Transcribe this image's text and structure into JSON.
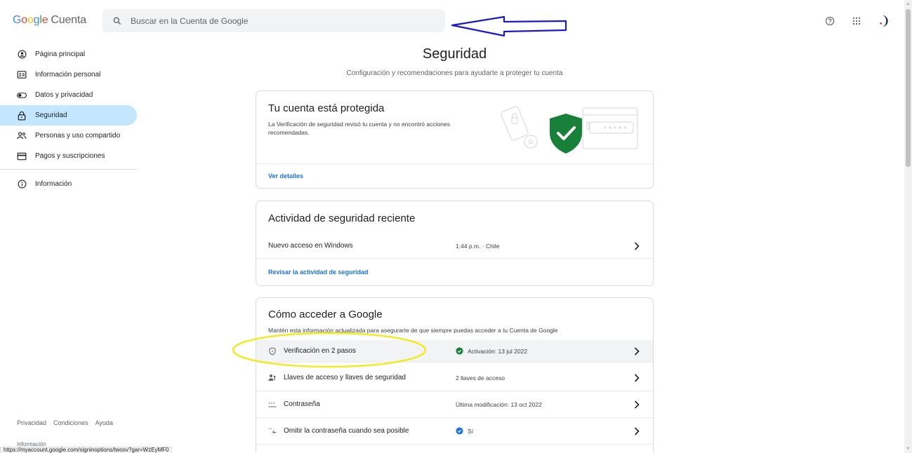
{
  "header": {
    "logo_google": "Google",
    "logo_account": "Cuenta",
    "search_placeholder": "Buscar en la Cuenta de Google",
    "brand_colors": {
      "blue": "#4285f4",
      "red": "#ea4335",
      "yellow": "#fbbc05",
      "green": "#34a853"
    },
    "icons": [
      "help-icon",
      "apps-grid-icon",
      "avatar"
    ]
  },
  "sidebar": {
    "items": [
      {
        "label": "Página principal",
        "icon": "account-circle-icon",
        "active": false
      },
      {
        "label": "Información personal",
        "icon": "id-card-icon",
        "active": false
      },
      {
        "label": "Datos y privacidad",
        "icon": "toggle-icon",
        "active": false
      },
      {
        "label": "Seguridad",
        "icon": "lock-icon",
        "active": true
      },
      {
        "label": "Personas y uso compartido",
        "icon": "people-icon",
        "active": false
      },
      {
        "label": "Pagos y suscripciones",
        "icon": "credit-card-icon",
        "active": false
      }
    ],
    "info_item": {
      "label": "Información",
      "icon": "info-icon"
    },
    "footer_links": [
      "Privacidad",
      "Condiciones",
      "Ayuda"
    ],
    "footer_info": "Información"
  },
  "status_url": "https://myaccount.google.com/signinoptions/twosv?gar=WzEyMF0",
  "main": {
    "title": "Seguridad",
    "subtitle": "Configuración y recomendaciones para ayudarte a proteger tu cuenta",
    "protected_card": {
      "title": "Tu cuenta está protegida",
      "desc_line1": "La Verificación de seguridad revisó tu cuenta y no encontró acciones",
      "desc_line2": "recomendadas.",
      "link": "Ver detalles",
      "shield_color": "#188038"
    },
    "activity_card": {
      "title": "Actividad de seguridad reciente",
      "row": {
        "label": "Nuevo acceso en Windows",
        "value": "1:44 p.m. · Chile"
      },
      "link": "Revisar la actividad de seguridad"
    },
    "signin_card": {
      "title": "Cómo acceder a Google",
      "desc": "Mantén esta información actualizada para asegurarte de que siempre puedas acceder a tu Cuenta de Google",
      "rows": [
        {
          "label": "Verificación en 2 pasos",
          "icon": "shield-icon",
          "value": "Activación: 13 jul 2022",
          "value_icon": "check-circle-icon",
          "value_icon_color": "#188038"
        },
        {
          "label": "Llaves de acceso y llaves de seguridad",
          "icon": "passkey-icon",
          "value": "2 llaves de acceso",
          "value_icon": ""
        },
        {
          "label": "Contraseña",
          "icon": "password-icon",
          "value": "Última modificación: 13 oct 2022",
          "value_icon": ""
        },
        {
          "label": "Omitir la contraseña cuando sea posible",
          "icon": "skip-password-icon",
          "value": "Sí",
          "value_icon": "check-circle-icon",
          "value_icon_color": "#1a73e8"
        }
      ]
    }
  },
  "annotations": {
    "arrow_color": "#1a1acc",
    "ellipse_color": "#f2ea1a"
  }
}
